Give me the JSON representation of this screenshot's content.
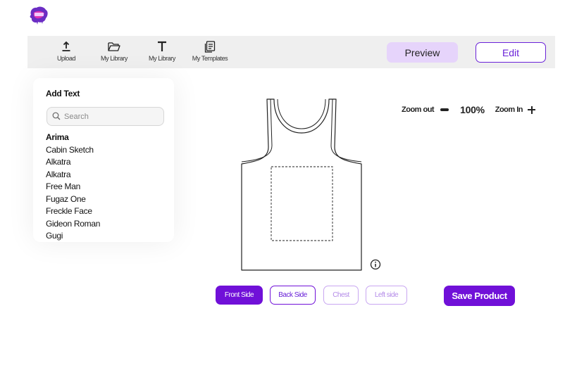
{
  "toolbar": {
    "tools": [
      {
        "label": "Upload",
        "icon": "upload-icon"
      },
      {
        "label": "My Library",
        "icon": "folder-icon"
      },
      {
        "label": "My Library",
        "icon": "text-icon"
      },
      {
        "label": "My Templates",
        "icon": "document-icon"
      }
    ],
    "preview_label": "Preview",
    "edit_label": "Edit"
  },
  "text_panel": {
    "title": "Add Text",
    "search_placeholder": "Search",
    "fonts": [
      "Arima",
      "Cabin Sketch",
      "Alkatra",
      "Alkatra",
      "Free Man",
      "Fugaz One",
      "Freckle Face",
      "Gideon Roman",
      "Gugi"
    ]
  },
  "zoom": {
    "out_label": "Zoom out",
    "level": "100%",
    "in_label": "Zoom In"
  },
  "sides": {
    "front": "Front Side",
    "back": "Back Side",
    "chest": "Chest",
    "left": "Left side",
    "active": "front"
  },
  "save_label": "Save Product",
  "colors": {
    "accent": "#7010d8",
    "accent_light": "#e6d4fb",
    "toolbar_bg": "#efefef"
  }
}
